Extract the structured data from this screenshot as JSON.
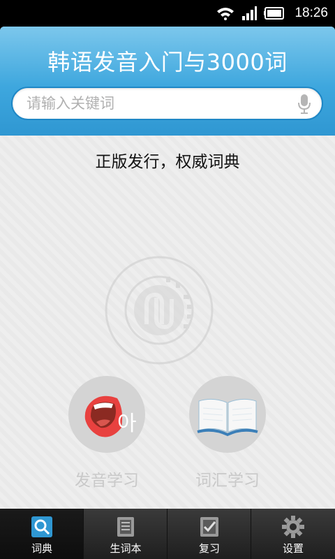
{
  "status_bar": {
    "time": "18:26"
  },
  "header": {
    "title": "韩语发音入门与3000词",
    "search_placeholder": "请输入关键词"
  },
  "content": {
    "tagline": "正版发行，权威词典",
    "features": [
      {
        "label": "发音学习",
        "icon": "mouth-icon"
      },
      {
        "label": "词汇学习",
        "icon": "book-icon"
      }
    ]
  },
  "bottom_nav": [
    {
      "label": "词典",
      "icon": "search-icon",
      "active": true
    },
    {
      "label": "生词本",
      "icon": "notebook-icon",
      "active": false
    },
    {
      "label": "复习",
      "icon": "checklist-icon",
      "active": false
    },
    {
      "label": "设置",
      "icon": "gear-icon",
      "active": false
    }
  ],
  "colors": {
    "header_blue": "#3ea7de",
    "search_border": "#1e87c6",
    "nav_bg": "#2a2a2a",
    "mouth_red": "#e8413f"
  }
}
